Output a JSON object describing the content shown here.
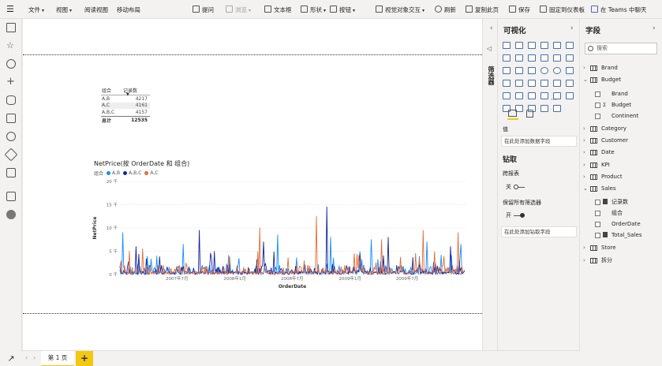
{
  "toolbar": {
    "file": "文件",
    "view": "视图",
    "reading_view": "阅读视图",
    "mobile_layout": "移动布局",
    "ask_question": "提问",
    "explore": "浏览",
    "textbox": "文本框",
    "shapes": "形状",
    "buttons": "按钮",
    "visual_interactions": "视觉对象交互",
    "refresh": "刷新",
    "duplicate_page": "复制此页",
    "save": "保存",
    "pin_dashboard": "固定到仪表板",
    "chat_teams": "在 Teams 中聊天"
  },
  "table_visual": {
    "headers": [
      "组合",
      "记录数"
    ],
    "rows": [
      {
        "label": "A,B",
        "value": "4217"
      },
      {
        "label": "A,C",
        "value": "4161"
      },
      {
        "label": "A,B,C",
        "value": "4157"
      }
    ],
    "total_label": "总计",
    "total_value": "12535"
  },
  "chart": {
    "title": "NetPrice(按 OrderDate 和 组合)",
    "legend_title": "组合",
    "colors": {
      "A,B": "#118dff",
      "A,B,C": "#12239e",
      "A,C": "#e66c37"
    }
  },
  "chart_data": {
    "type": "line",
    "title": "NetPrice(按 OrderDate 和 组合)",
    "xlabel": "OrderDate",
    "ylabel": "NetPrice",
    "y_tick_labels": [
      "20 千",
      "15 千",
      "10 千",
      "5 千",
      "0 千"
    ],
    "x_tick_labels": [
      "2007年7月",
      "2008年1月",
      "2008年7月",
      "2009年1月",
      "2009年7月"
    ],
    "ylim": [
      0,
      20000
    ],
    "x_range": [
      "2007-01-01",
      "2009-12-31"
    ],
    "legend_position": "top-left",
    "series": [
      {
        "name": "A,B",
        "peaks": [
          [
            "2007-01-10",
            9000
          ],
          [
            "2007-07-20",
            6500
          ],
          [
            "2008-05-15",
            8500
          ],
          [
            "2008-11-01",
            8000
          ],
          [
            "2009-03-10",
            7500
          ],
          [
            "2009-09-01",
            7000
          ],
          [
            "2009-12-20",
            6500
          ]
        ]
      },
      {
        "name": "A,B,C",
        "peaks": [
          [
            "2007-02-20",
            6000
          ],
          [
            "2007-09-10",
            9500
          ],
          [
            "2008-04-01",
            7000
          ],
          [
            "2008-10-20",
            14500
          ],
          [
            "2009-05-01",
            8000
          ],
          [
            "2009-11-15",
            6000
          ]
        ]
      },
      {
        "name": "A,C",
        "peaks": [
          [
            "2007-03-15",
            5500
          ],
          [
            "2008-03-20",
            10000
          ],
          [
            "2008-09-15",
            12500
          ],
          [
            "2009-04-10",
            7500
          ],
          [
            "2009-08-20",
            9500
          ],
          [
            "2009-12-10",
            9000
          ]
        ]
      }
    ]
  },
  "tabs": {
    "page1": "第 1 页",
    "add": "+"
  },
  "filters_label": "筛选器",
  "viz_pane": {
    "title": "可视化",
    "values_label": "值",
    "values_placeholder": "在此处添加数据字段",
    "drillthrough_title": "钻取",
    "cross_report_label": "跨报表",
    "cross_report_value": "关",
    "keep_filters_label": "保留所有筛选器",
    "keep_filters_value": "开",
    "drillthrough_placeholder": "在此处添加钻取字段",
    "more_icon": "···"
  },
  "fields_pane": {
    "title": "字段",
    "search_placeholder": "搜索",
    "tables": [
      {
        "name": "Brand",
        "expanded": false
      },
      {
        "name": "Budget",
        "expanded": true,
        "fields": [
          {
            "name": "Brand",
            "type": ""
          },
          {
            "name": "Budget",
            "type": "Σ"
          },
          {
            "name": "Continent",
            "type": ""
          }
        ]
      },
      {
        "name": "Category",
        "expanded": false
      },
      {
        "name": "Customer",
        "expanded": false
      },
      {
        "name": "Date",
        "expanded": false
      },
      {
        "name": "KPI",
        "expanded": false
      },
      {
        "name": "Product",
        "expanded": false
      },
      {
        "name": "Sales",
        "expanded": true,
        "fields": [
          {
            "name": "记录数",
            "type": "calc"
          },
          {
            "name": "组合",
            "type": ""
          },
          {
            "name": "OrderDate",
            "type": ""
          },
          {
            "name": "Total_Sales",
            "type": "calc"
          }
        ]
      },
      {
        "name": "Store",
        "expanded": false
      },
      {
        "name": "拆分",
        "expanded": false
      }
    ]
  }
}
